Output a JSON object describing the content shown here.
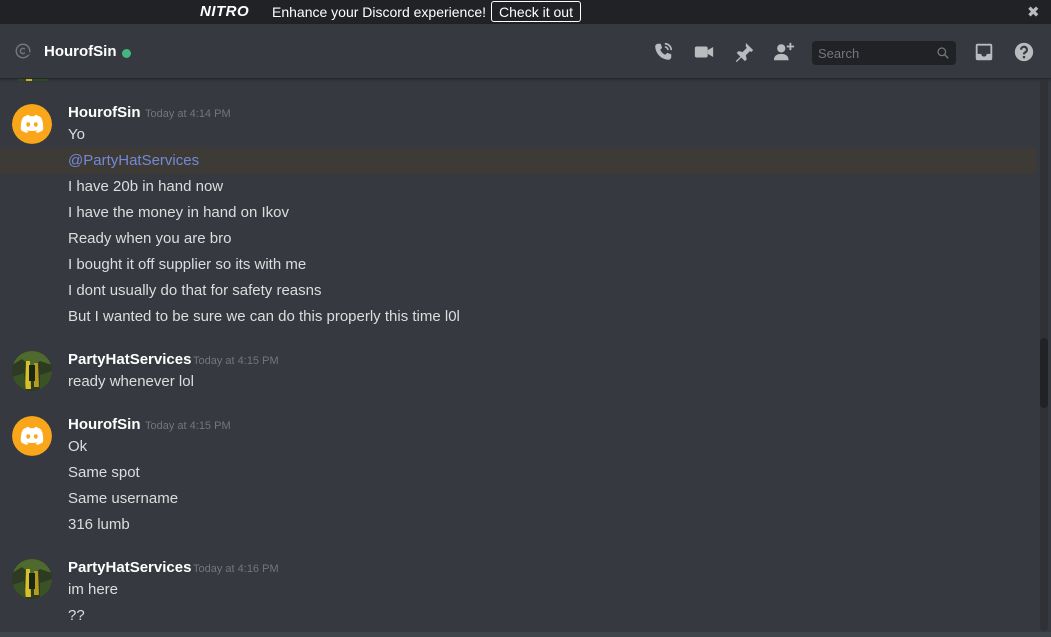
{
  "banner": {
    "logo": "NITRO",
    "text": "Enhance your Discord experience!",
    "button": "Check it out",
    "close_glyph": "✖"
  },
  "header": {
    "channel_name": "HourofSin",
    "status": "online",
    "status_color": "#43b581",
    "icons": [
      "at-icon",
      "voice-call-icon",
      "video-call-icon",
      "pin-icon",
      "add-friend-icon",
      "inbox-icon",
      "help-icon"
    ],
    "search": {
      "placeholder": "Search",
      "value": ""
    }
  },
  "colors": {
    "background": "#36393f",
    "mention_text": "#7289da",
    "mention_highlight": "#3e3b37",
    "discord_avatar": "#faa61a"
  },
  "messages": [
    {
      "author": "HourofSin",
      "timestamp": "Today at 4:14 PM",
      "avatar": "discord-default-avatar-icon",
      "lines": [
        "Yo",
        "@PartyHatServices",
        "I have 20b in hand now",
        "I have the money in hand on Ikov",
        "Ready when you are bro",
        "I bought it off supplier so its with me",
        "I dont usually do that for safety reasns",
        "But I wanted to be sure we can do this properly this time l0l"
      ]
    },
    {
      "author": "PartyHatServices",
      "timestamp": "Today at 4:15 PM",
      "avatar": "user-avatar-image",
      "lines": [
        "ready whenever lol"
      ]
    },
    {
      "author": "HourofSin",
      "timestamp": "Today at 4:15 PM",
      "avatar": "discord-default-avatar-icon",
      "lines": [
        "Ok",
        "Same spot",
        "Same username",
        "316 lumb"
      ]
    },
    {
      "author": "PartyHatServices",
      "timestamp": "Today at 4:16 PM",
      "avatar": "user-avatar-image",
      "lines": [
        "im here",
        "??"
      ]
    }
  ]
}
